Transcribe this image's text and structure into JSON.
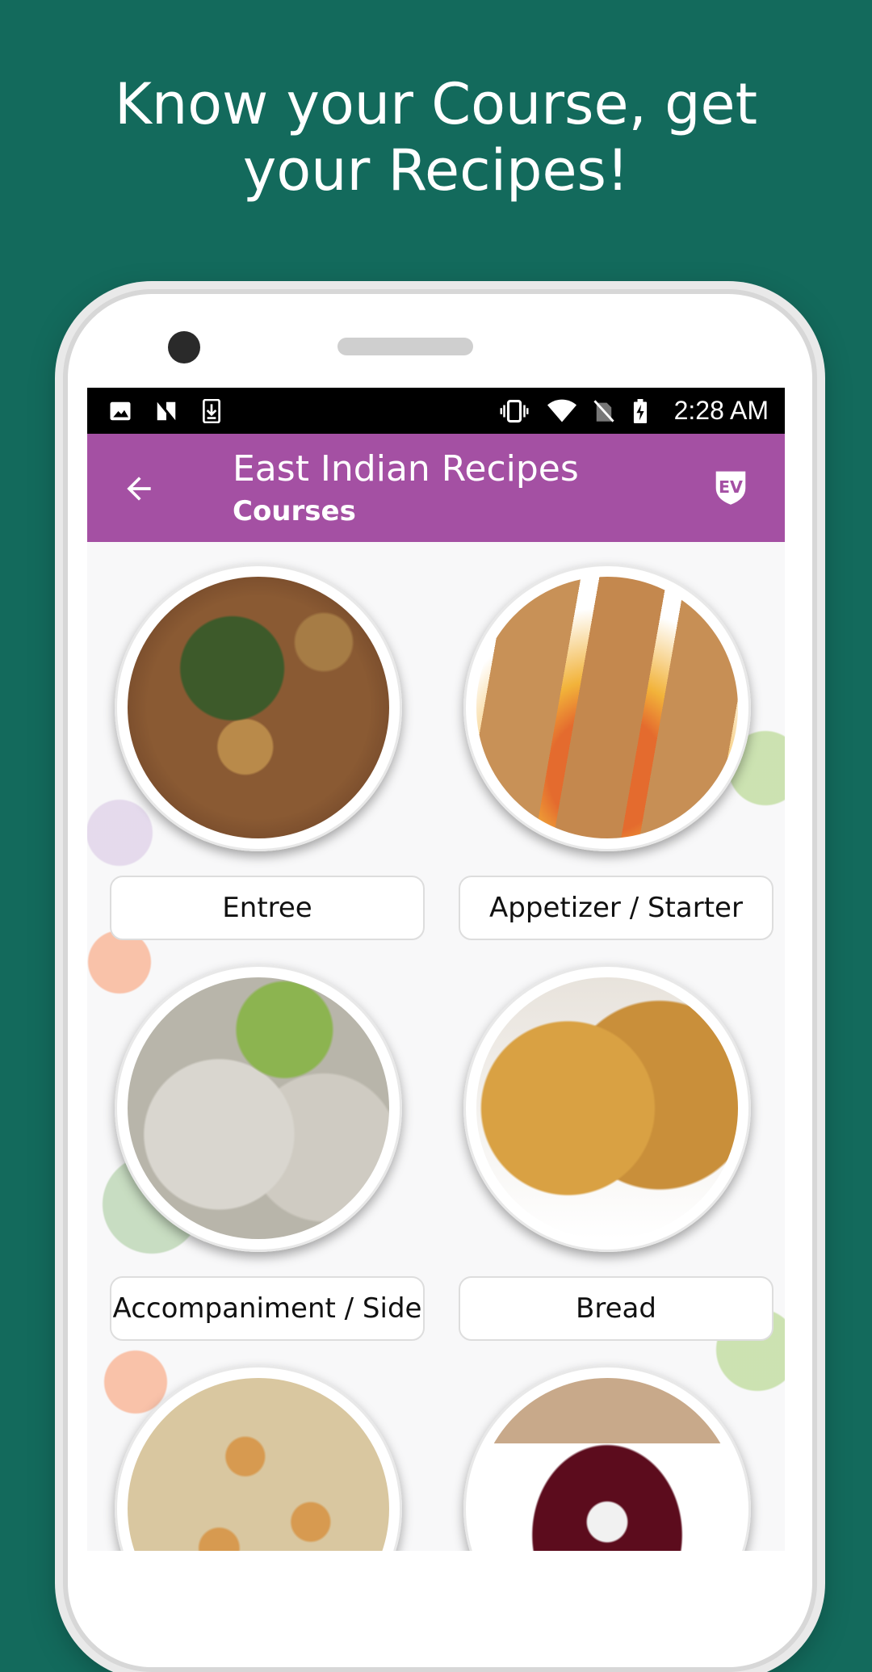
{
  "promo": {
    "headline": "Know your Course, get your Recipes!"
  },
  "status_bar": {
    "time": "2:28 AM",
    "left_icons": [
      "image-icon",
      "n-icon",
      "download-icon"
    ],
    "right_icons": [
      "vibrate-icon",
      "wifi-icon",
      "no-sim-icon",
      "battery-charging-icon"
    ]
  },
  "app_bar": {
    "title": "East Indian Recipes",
    "subtitle": "Courses",
    "back_icon": "arrow-left-icon",
    "logo_icon": "ev-logo-icon"
  },
  "courses": [
    {
      "label": "Entree"
    },
    {
      "label": "Appetizer / Starter"
    },
    {
      "label": "Accompaniment / Side"
    },
    {
      "label": "Bread"
    },
    {
      "label": ""
    },
    {
      "label": ""
    }
  ],
  "colors": {
    "background": "#136a5c",
    "app_bar": "#a450a3",
    "status_bar": "#000000"
  }
}
